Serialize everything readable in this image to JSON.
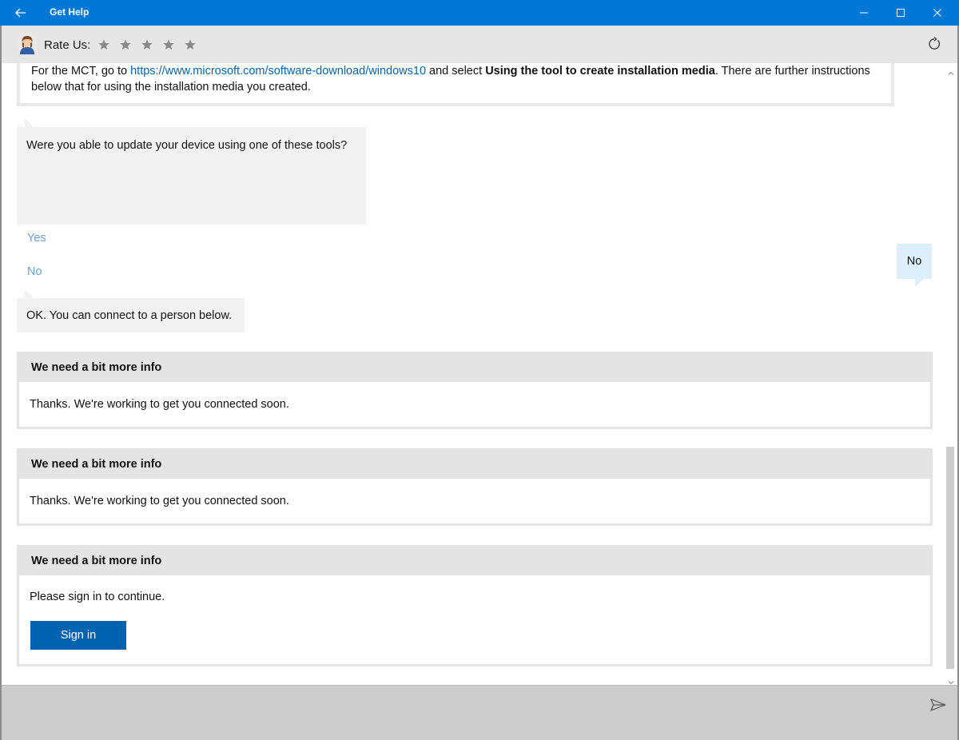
{
  "window": {
    "title": "Get Help",
    "accent_color": "#0078d7"
  },
  "header": {
    "rate_label": "Rate Us:",
    "stars": [
      "★",
      "★",
      "★",
      "★",
      "★"
    ]
  },
  "chat": {
    "top_card": {
      "prefix": "For the MCT, go to ",
      "link": "https://www.microsoft.com/software-download/windows10",
      "middle": " and select ",
      "bold": "Using the tool to create installation media",
      "suffix": ". There are further instructions below that for using the installation media you created."
    },
    "question": {
      "text": "Were you able to update your device using one of these tools?",
      "options": [
        "Yes",
        "No"
      ]
    },
    "user_reply": "No",
    "bot_reply": "OK. You can connect to a person below.",
    "info_cards": [
      {
        "title": "We need a bit more info",
        "body": "Thanks. We're working to get you connected soon."
      },
      {
        "title": "We need a bit more info",
        "body": "Thanks. We're working to get you connected soon."
      },
      {
        "title": "We need a bit more info",
        "body": "Please sign in to continue.",
        "button": "Sign in"
      }
    ]
  },
  "icons": {
    "back": "back-arrow-icon",
    "minimize": "minimize-icon",
    "maximize": "maximize-icon",
    "close": "close-icon",
    "refresh": "refresh-icon",
    "send": "send-icon",
    "avatar": "avatar-icon"
  }
}
